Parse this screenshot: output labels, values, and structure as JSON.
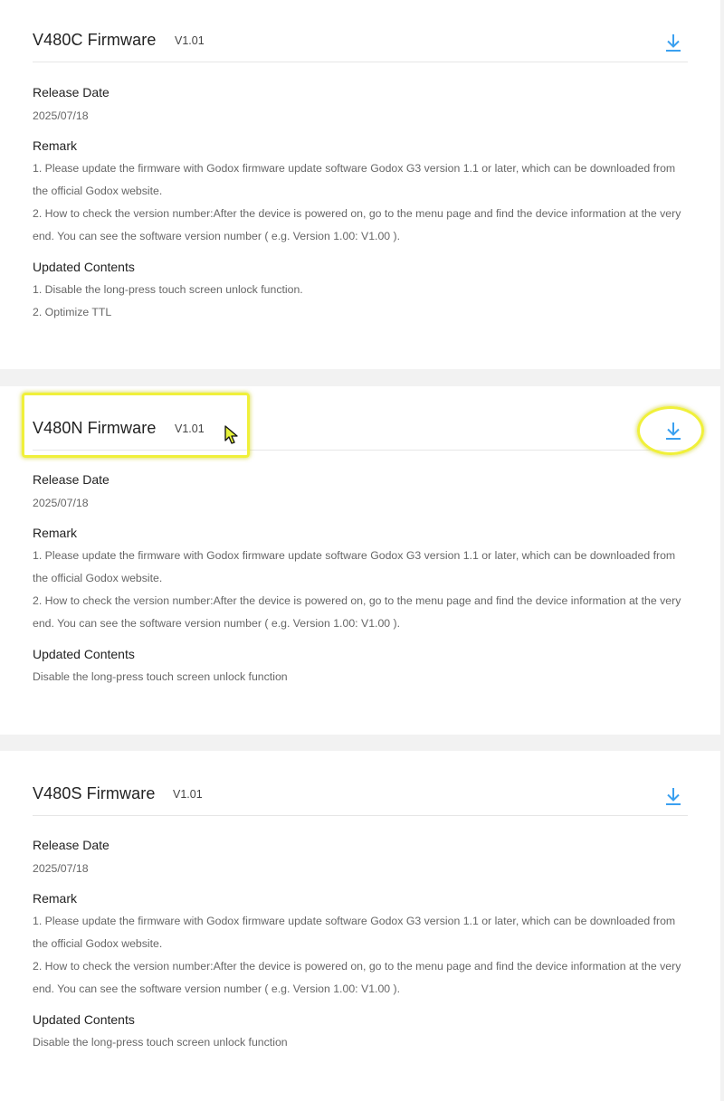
{
  "firmware_entries": [
    {
      "title": "V480C Firmware",
      "version": "V1.01",
      "release_date_label": "Release Date",
      "release_date": "2025/07/18",
      "remark_label": "Remark",
      "remark_lines": [
        "1. Please update the firmware with Godox firmware update software Godox G3 version 1.1 or later, which can be downloaded from the official Godox website.",
        "2. How to check the version number:After the device is powered on, go to the menu page and find the device information at the very end. You can see the software version number ( e.g. Version 1.00: V1.00 )."
      ],
      "updated_contents_label": "Updated Contents",
      "updated_contents": [
        "1. Disable the long-press touch screen unlock function.",
        "2. Optimize TTL"
      ]
    },
    {
      "title": "V480N Firmware",
      "version": "V1.01",
      "release_date_label": "Release Date",
      "release_date": "2025/07/18",
      "remark_label": "Remark",
      "remark_lines": [
        "1. Please update the firmware with Godox firmware update software Godox G3 version 1.1 or later, which can be downloaded from the official Godox website.",
        "2. How to check the version number:After the device is powered on, go to the menu page and find the device information at the very end. You can see the software version number ( e.g. Version 1.00: V1.00 )."
      ],
      "updated_contents_label": "Updated Contents",
      "updated_contents": [
        "Disable the long-press touch screen unlock function"
      ]
    },
    {
      "title": "V480S Firmware",
      "version": "V1.01",
      "release_date_label": "Release Date",
      "release_date": "2025/07/18",
      "remark_label": "Remark",
      "remark_lines": [
        "1. Please update the firmware with Godox firmware update software Godox G3 version 1.1 or later, which can be downloaded from the official Godox website.",
        "2. How to check the version number:After the device is powered on, go to the menu page and find the device information at the very end. You can see the software version number ( e.g. Version 1.00: V1.00 )."
      ],
      "updated_contents_label": "Updated Contents",
      "updated_contents": [
        "Disable the long-press touch screen unlock function"
      ]
    }
  ],
  "icons": {
    "download": "download-icon",
    "cursor": "mouse-pointer-icon"
  },
  "colors": {
    "download_icon": "#3aa0f0",
    "highlight": "#f0f03a",
    "page_background": "#f2f2f2",
    "card_background": "#ffffff"
  }
}
